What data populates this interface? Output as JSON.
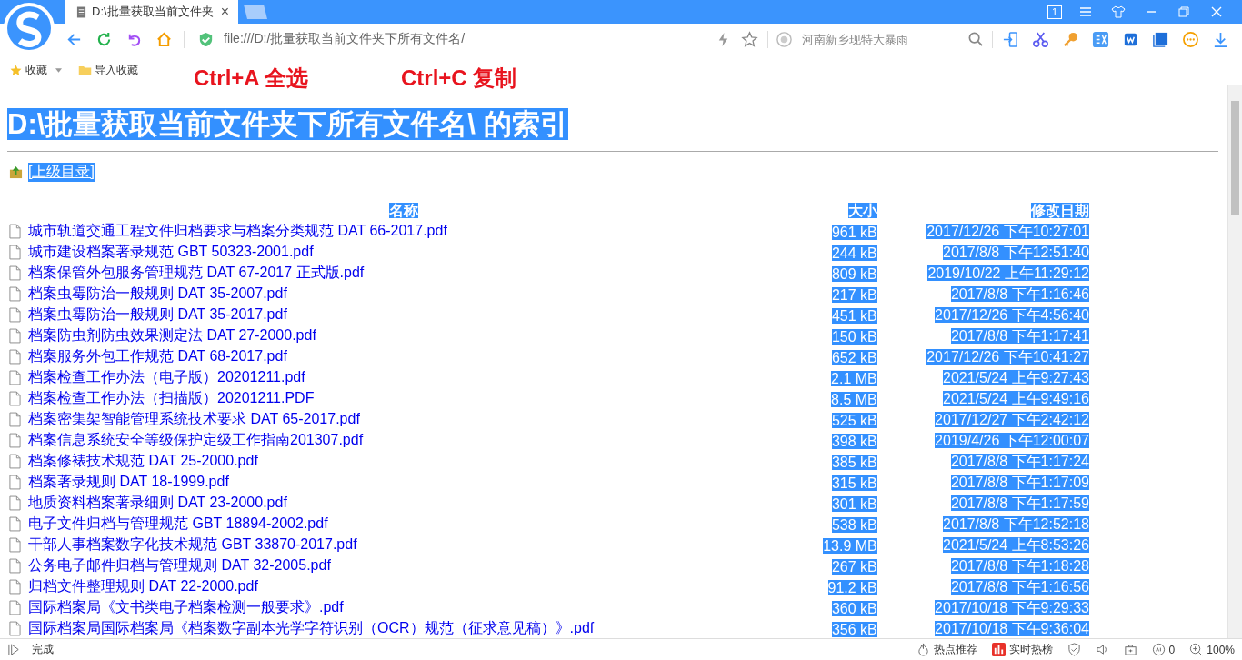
{
  "tab": {
    "title": "D:\\批量获取当前文件夹",
    "close": "×"
  },
  "window_controls": {
    "tab_count": "1"
  },
  "address_bar": {
    "url": "file:///D:/批量获取当前文件夹下所有文件名/"
  },
  "search": {
    "placeholder": "河南新乡现特大暴雨"
  },
  "bookmarks_bar": {
    "items": [
      "收藏",
      "导入收藏"
    ]
  },
  "annotations": [
    "Ctrl+A 全选",
    "Ctrl+C 复制"
  ],
  "page": {
    "selection_highlight": true,
    "heading": "D:\\批量获取当前文件夹下所有文件名\\ 的索引",
    "parent_link": "[上级目录]",
    "table": {
      "columns": [
        "名称",
        "大小",
        "修改日期"
      ],
      "rows": [
        {
          "name": "城市轨道交通工程文件归档要求与档案分类规范 DAT 66-2017.pdf",
          "size": "961 kB",
          "modified": "2017/12/26 下午10:27:01"
        },
        {
          "name": "城市建设档案著录规范 GBT 50323-2001.pdf",
          "size": "244 kB",
          "modified": "2017/8/8 下午12:51:40"
        },
        {
          "name": "档案保管外包服务管理规范 DAT 67-2017 正式版.pdf",
          "size": "809 kB",
          "modified": "2019/10/22 上午11:29:12"
        },
        {
          "name": "档案虫霉防治一般规则 DAT 35-2007.pdf",
          "size": "217 kB",
          "modified": "2017/8/8 下午1:16:46"
        },
        {
          "name": "档案虫霉防治一般规则 DAT 35-2017.pdf",
          "size": "451 kB",
          "modified": "2017/12/26 下午4:56:40"
        },
        {
          "name": "档案防虫剂防虫效果测定法 DAT 27-2000.pdf",
          "size": "150 kB",
          "modified": "2017/8/8 下午1:17:41"
        },
        {
          "name": "档案服务外包工作规范 DAT 68-2017.pdf",
          "size": "652 kB",
          "modified": "2017/12/26 下午10:41:27"
        },
        {
          "name": "档案检查工作办法（电子版）20201211.pdf",
          "size": "2.1 MB",
          "modified": "2021/5/24 上午9:27:43"
        },
        {
          "name": "档案检查工作办法（扫描版）20201211.PDF",
          "size": "8.5 MB",
          "modified": "2021/5/24 上午9:49:16"
        },
        {
          "name": "档案密集架智能管理系统技术要求 DAT 65-2017.pdf",
          "size": "525 kB",
          "modified": "2017/12/27 下午2:42:12"
        },
        {
          "name": "档案信息系统安全等级保护定级工作指南201307.pdf",
          "size": "398 kB",
          "modified": "2019/4/26 下午12:00:07"
        },
        {
          "name": "档案修裱技术规范 DAT 25-2000.pdf",
          "size": "385 kB",
          "modified": "2017/8/8 下午1:17:24"
        },
        {
          "name": "档案著录规则 DAT 18-1999.pdf",
          "size": "315 kB",
          "modified": "2017/8/8 下午1:17:09"
        },
        {
          "name": "地质资料档案著录细则 DAT 23-2000.pdf",
          "size": "301 kB",
          "modified": "2017/8/8 下午1:17:59"
        },
        {
          "name": "电子文件归档与管理规范 GBT 18894-2002.pdf",
          "size": "538 kB",
          "modified": "2017/8/8 下午12:52:18"
        },
        {
          "name": "干部人事档案数字化技术规范 GBT 33870-2017.pdf",
          "size": "13.9 MB",
          "modified": "2021/5/24 上午8:53:26"
        },
        {
          "name": "公务电子邮件归档与管理规则 DAT 32-2005.pdf",
          "size": "267 kB",
          "modified": "2017/8/8 下午1:18:28"
        },
        {
          "name": "归档文件整理规则 DAT 22-2000.pdf",
          "size": "91.2 kB",
          "modified": "2017/8/8 下午1:16:56"
        },
        {
          "name": "国际档案局《文书类电子档案检测一般要求》.pdf",
          "size": "360 kB",
          "modified": "2017/10/18 下午9:29:33"
        },
        {
          "name": "国际档案局国际档案局《档案数字副本光学字符识别（OCR）规范（征求意见稿）》.pdf",
          "size": "356 kB",
          "modified": "2017/10/18 下午9:36:04"
        }
      ]
    }
  },
  "status_bar": {
    "status": "完成",
    "items": [
      "热点推荐",
      "实时热榜"
    ],
    "ad_count": "0",
    "zoom": "100%"
  }
}
